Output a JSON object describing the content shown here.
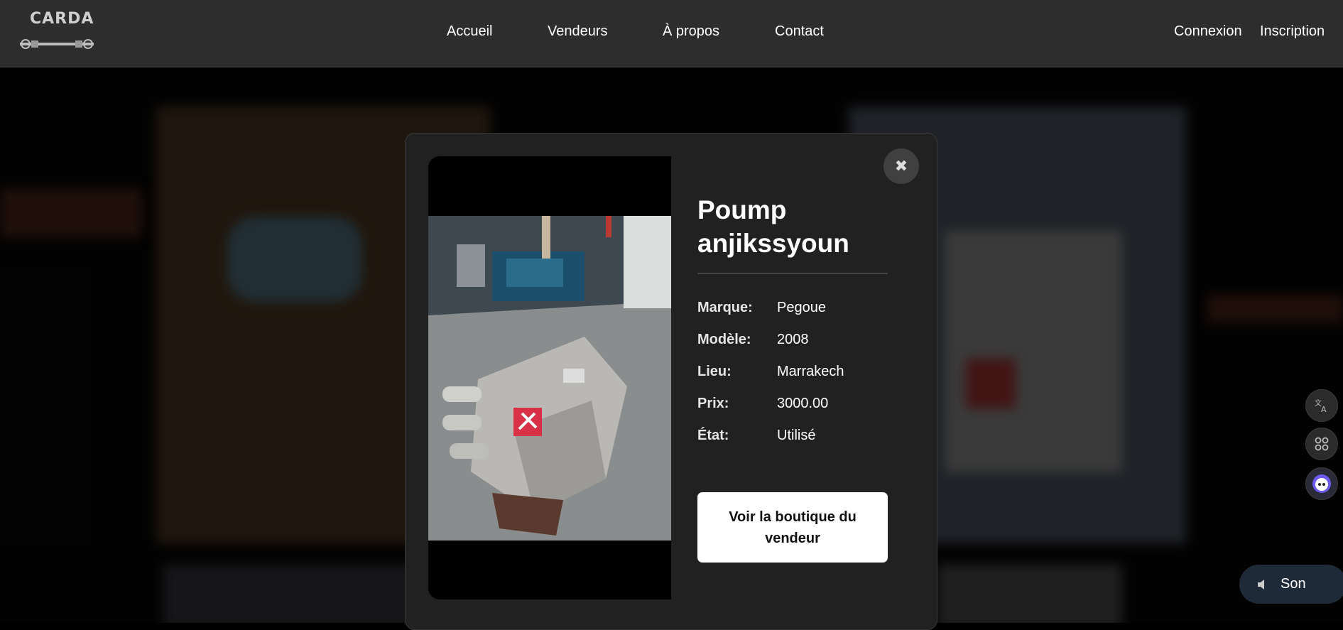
{
  "brand": {
    "logo_text": "CARDA"
  },
  "nav": {
    "home": "Accueil",
    "sellers": "Vendeurs",
    "about": "À propos",
    "contact": "Contact"
  },
  "auth": {
    "login": "Connexion",
    "register": "Inscription"
  },
  "modal": {
    "close_symbol": "✖",
    "title": "Poump anjikssyoun",
    "specs": [
      {
        "label": "Marque:",
        "value": "Pegoue"
      },
      {
        "label": "Modèle:",
        "value": "2008"
      },
      {
        "label": "Lieu:",
        "value": "Marrakech"
      },
      {
        "label": "Prix:",
        "value": "3000.00"
      },
      {
        "label": "État:",
        "value": "Utilisé"
      }
    ],
    "shop_button": "Voir la boutique du vendeur",
    "photo_icon": "pump-product-photo"
  },
  "side_tools": {
    "translate_icon": "translate-icon",
    "apps_icon": "command-icon",
    "assistant_icon": "assistant-face-icon"
  },
  "sound": {
    "label": "Son",
    "icon": "speaker-icon"
  },
  "colors": {
    "header_bg": "#2d2d2d",
    "modal_bg": "#212121",
    "button_bg": "#ffffff",
    "sound_bg": "#1e2a38"
  }
}
